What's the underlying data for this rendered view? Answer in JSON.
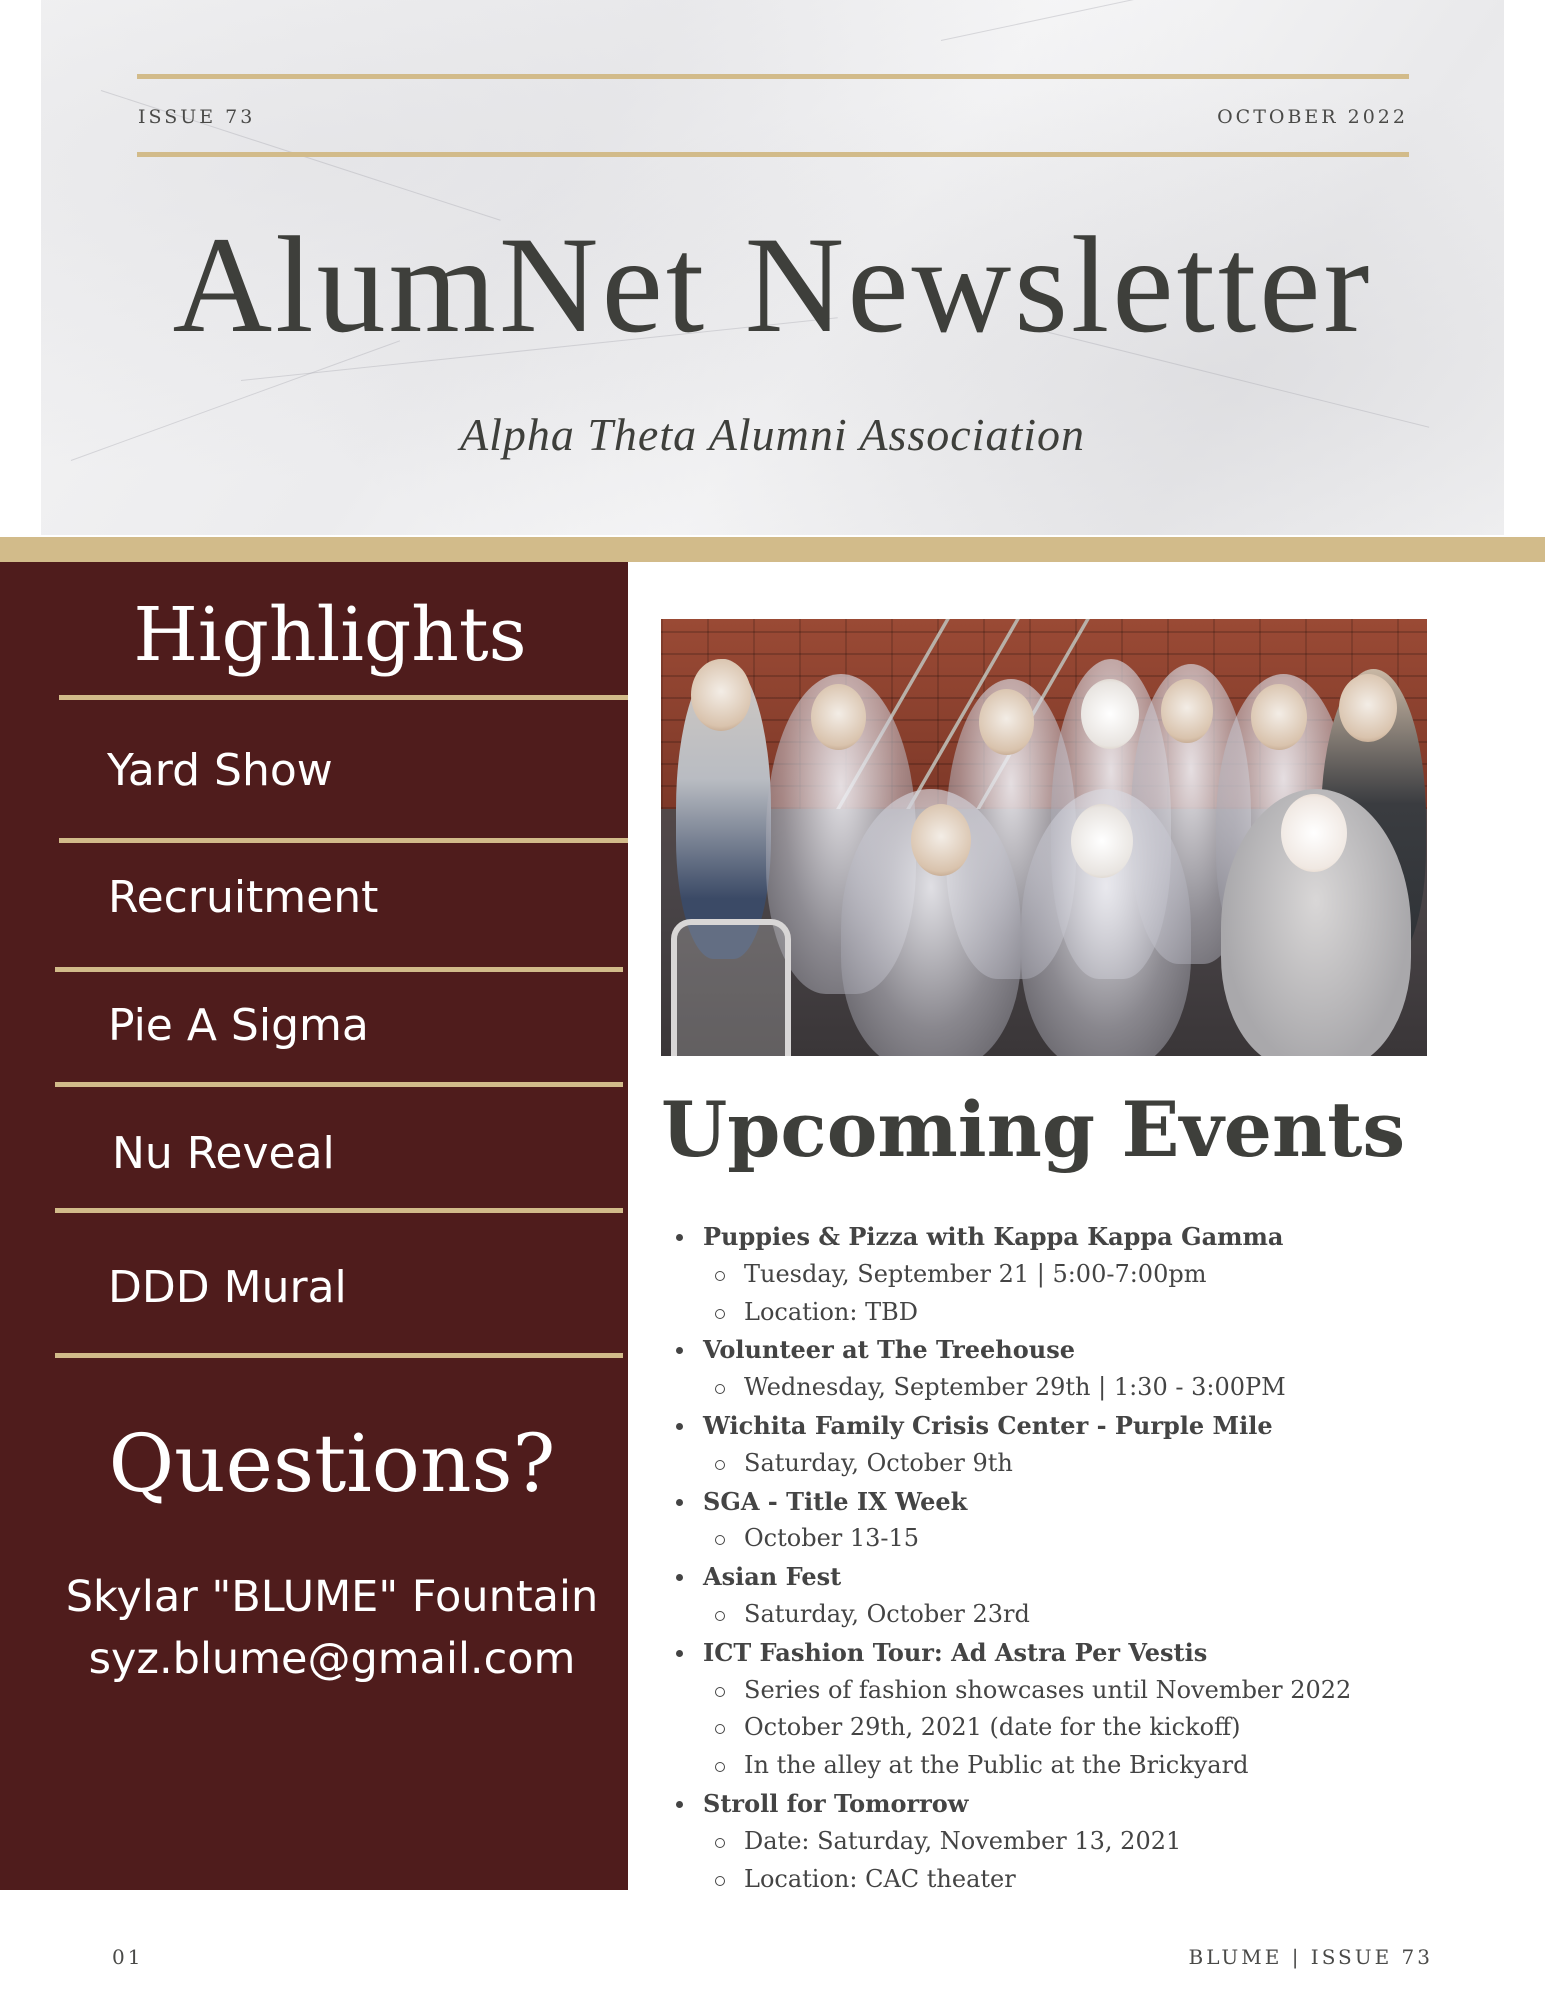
{
  "header": {
    "issue": "ISSUE 73",
    "date": "OCTOBER 2022",
    "title": "AlumNet Newsletter",
    "subtitle": "Alpha Theta Alumni Association"
  },
  "sidebar": {
    "highlights_title": "Highlights",
    "highlights": [
      {
        "label": "Yard Show"
      },
      {
        "label": "Recruitment"
      },
      {
        "label": "Pie A Sigma"
      },
      {
        "label": "Nu Reveal"
      },
      {
        "label": "DDD Mural"
      }
    ],
    "questions_title": "Questions?",
    "contact_name": "Skylar \"BLUME\" Fountain",
    "contact_email": "syz.blume@gmail.com"
  },
  "events": {
    "title": "Upcoming Events",
    "items": [
      {
        "name": "Puppies & Pizza with Kappa Kappa Gamma",
        "details": [
          "Tuesday, September 21 | 5:00-7:00pm",
          "Location: TBD"
        ]
      },
      {
        "name": "Volunteer at The Treehouse",
        "details": [
          "Wednesday, September 29th | 1:30 - 3:00PM"
        ]
      },
      {
        "name": "Wichita Family Crisis Center - Purple Mile",
        "details": [
          "Saturday, October 9th"
        ]
      },
      {
        "name": "SGA - Title IX Week",
        "details": [
          "October 13-15"
        ]
      },
      {
        "name": "Asian Fest",
        "details": [
          "Saturday, October 23rd"
        ]
      },
      {
        "name": "ICT Fashion Tour: Ad Astra Per Vestis",
        "details": [
          "Series of fashion showcases until November 2022",
          "October 29th, 2021 (date for the kickoff)",
          "In the alley at the Public at the Brickyard"
        ]
      },
      {
        "name": "Stroll for Tomorrow",
        "details": [
          "Date: Saturday, November 13, 2021",
          "Location: CAC theater"
        ]
      }
    ]
  },
  "footer": {
    "page": "01",
    "right": "BLUME | ISSUE 73"
  },
  "colors": {
    "gold": "#d2bb8a",
    "maroon": "#4f1c1c",
    "title_gray": "#3e3f3b"
  }
}
